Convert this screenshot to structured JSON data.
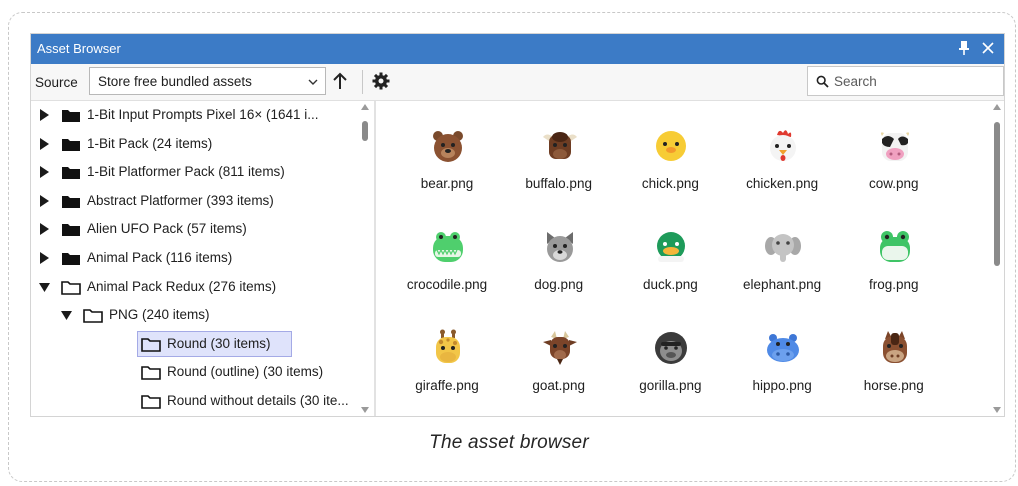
{
  "window": {
    "title": "Asset Browser"
  },
  "toolbar": {
    "source_label": "Source",
    "source_value": "Store free bundled assets",
    "search_placeholder": "Search"
  },
  "tree": {
    "items": [
      {
        "label": "1-Bit Input Prompts Pixel 16× (1641 i...",
        "level": 0,
        "state": "collapsed"
      },
      {
        "label": "1-Bit Pack (24 items)",
        "level": 0,
        "state": "collapsed"
      },
      {
        "label": "1-Bit Platformer Pack (811 items)",
        "level": 0,
        "state": "collapsed"
      },
      {
        "label": "Abstract Platformer (393 items)",
        "level": 0,
        "state": "collapsed"
      },
      {
        "label": "Alien UFO Pack (57 items)",
        "level": 0,
        "state": "collapsed"
      },
      {
        "label": "Animal Pack (116 items)",
        "level": 0,
        "state": "collapsed"
      },
      {
        "label": "Animal Pack Redux (276 items)",
        "level": 0,
        "state": "expanded"
      },
      {
        "label": "PNG (240 items)",
        "level": 1,
        "state": "expanded"
      },
      {
        "label": "Round (30 items)",
        "level": 2,
        "state": "leaf",
        "selected": true
      },
      {
        "label": "Round (outline) (30 items)",
        "level": 2,
        "state": "leaf"
      },
      {
        "label": "Round without details (30 ite...",
        "level": 2,
        "state": "leaf"
      }
    ]
  },
  "assets": [
    {
      "name": "bear.png",
      "icon": "bear-icon"
    },
    {
      "name": "buffalo.png",
      "icon": "buffalo-icon"
    },
    {
      "name": "chick.png",
      "icon": "chick-icon"
    },
    {
      "name": "chicken.png",
      "icon": "chicken-icon"
    },
    {
      "name": "cow.png",
      "icon": "cow-icon"
    },
    {
      "name": "crocodile.png",
      "icon": "crocodile-icon"
    },
    {
      "name": "dog.png",
      "icon": "dog-icon"
    },
    {
      "name": "duck.png",
      "icon": "duck-icon"
    },
    {
      "name": "elephant.png",
      "icon": "elephant-icon"
    },
    {
      "name": "frog.png",
      "icon": "frog-icon"
    },
    {
      "name": "giraffe.png",
      "icon": "giraffe-icon"
    },
    {
      "name": "goat.png",
      "icon": "goat-icon"
    },
    {
      "name": "gorilla.png",
      "icon": "gorilla-icon"
    },
    {
      "name": "hippo.png",
      "icon": "hippo-icon"
    },
    {
      "name": "horse.png",
      "icon": "horse-icon"
    }
  ],
  "caption": "The asset browser",
  "colors": {
    "titlebar": "#3c7bc6",
    "selection_bg": "#dfe3fb",
    "selection_border": "#a4aae6"
  }
}
